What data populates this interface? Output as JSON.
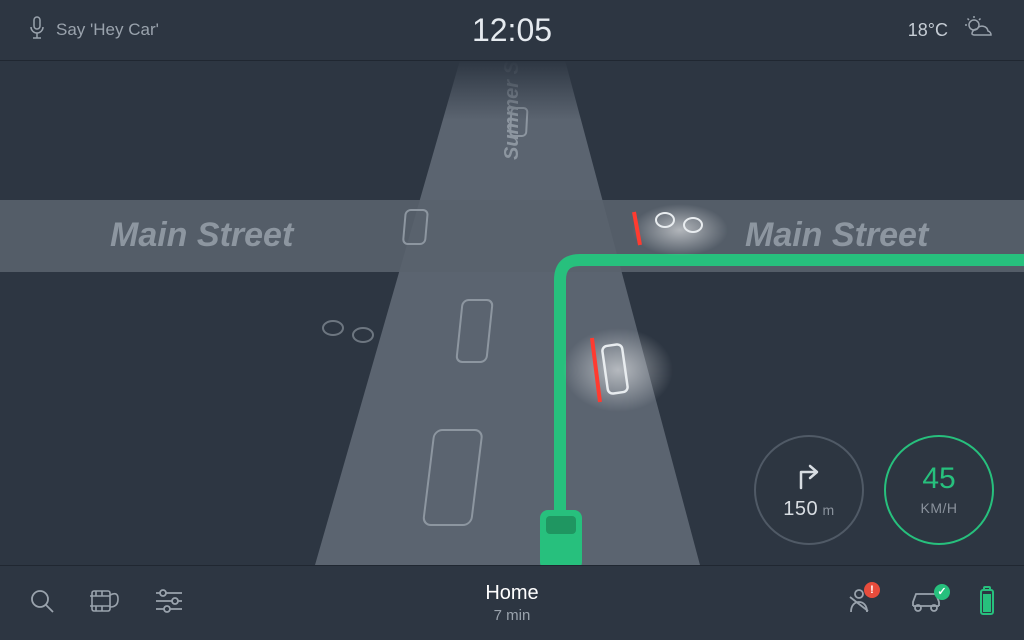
{
  "topbar": {
    "voice_hint": "Say 'Hey Car'",
    "clock": "12:05",
    "temperature": "18°C"
  },
  "map": {
    "street_horizontal": "Main Street",
    "street_vertical": "Summer Str"
  },
  "turn": {
    "distance_value": "150",
    "distance_unit": "m"
  },
  "speed": {
    "value": "45",
    "unit": "KM/H"
  },
  "destination": {
    "name": "Home",
    "eta": "7 min"
  },
  "icons": {
    "mic": "microphone",
    "weather": "partly-cloudy",
    "search": "search",
    "media": "media-film",
    "settings": "sliders",
    "seatbelt": "seatbelt-warning",
    "car": "car-status",
    "battery": "battery"
  },
  "colors": {
    "accent": "#27c07d",
    "danger": "#e74c3c",
    "road": "#59626d",
    "bg": "#2d3642"
  }
}
